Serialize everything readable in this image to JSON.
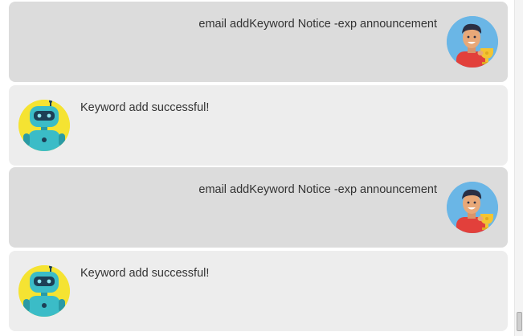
{
  "messages": [
    {
      "role": "user",
      "text": "email addKeyword Notice -exp announcement",
      "avatar": "user-trophy-avatar"
    },
    {
      "role": "bot",
      "text": "Keyword add successful!",
      "avatar": "robot-avatar"
    },
    {
      "role": "user",
      "text": "email addKeyword Notice -exp announcement",
      "avatar": "user-trophy-avatar"
    },
    {
      "role": "bot",
      "text": "Keyword add successful!",
      "avatar": "robot-avatar"
    }
  ],
  "colors": {
    "user_bubble": "#dcdcdc",
    "bot_bubble": "#ededed",
    "user_avatar_bg": "#6ab6e6",
    "bot_avatar_bg": "#f5e332",
    "text": "#333333"
  }
}
